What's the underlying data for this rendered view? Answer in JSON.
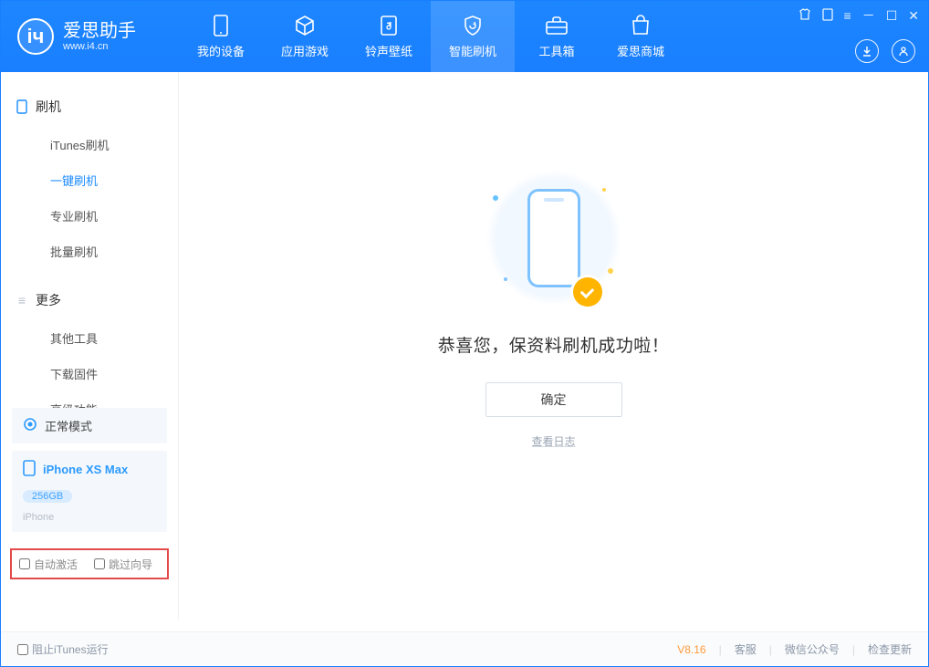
{
  "brand": {
    "name_cn": "爱思助手",
    "name_en": "www.i4.cn"
  },
  "nav": {
    "my_device": "我的设备",
    "apps_games": "应用游戏",
    "ring_wall": "铃声壁纸",
    "smart_flash": "智能刷机",
    "toolbox": "工具箱",
    "store": "爱思商城"
  },
  "sidebar": {
    "flash_title": "刷机",
    "items": {
      "itunes": "iTunes刷机",
      "oneclick": "一键刷机",
      "pro": "专业刷机",
      "batch": "批量刷机"
    },
    "more_title": "更多",
    "more": {
      "other_tools": "其他工具",
      "download_fw": "下载固件",
      "advanced": "高级功能"
    }
  },
  "device": {
    "mode": "正常模式",
    "name": "iPhone XS Max",
    "storage": "256GB",
    "type": "iPhone"
  },
  "checks": {
    "auto_activate": "自动激活",
    "skip_guide": "跳过向导"
  },
  "main": {
    "success": "恭喜您，保资料刷机成功啦！",
    "ok": "确定",
    "view_log": "查看日志"
  },
  "footer": {
    "block_itunes": "阻止iTunes运行",
    "version": "V8.16",
    "kf": "客服",
    "wx": "微信公众号",
    "update": "检查更新"
  }
}
